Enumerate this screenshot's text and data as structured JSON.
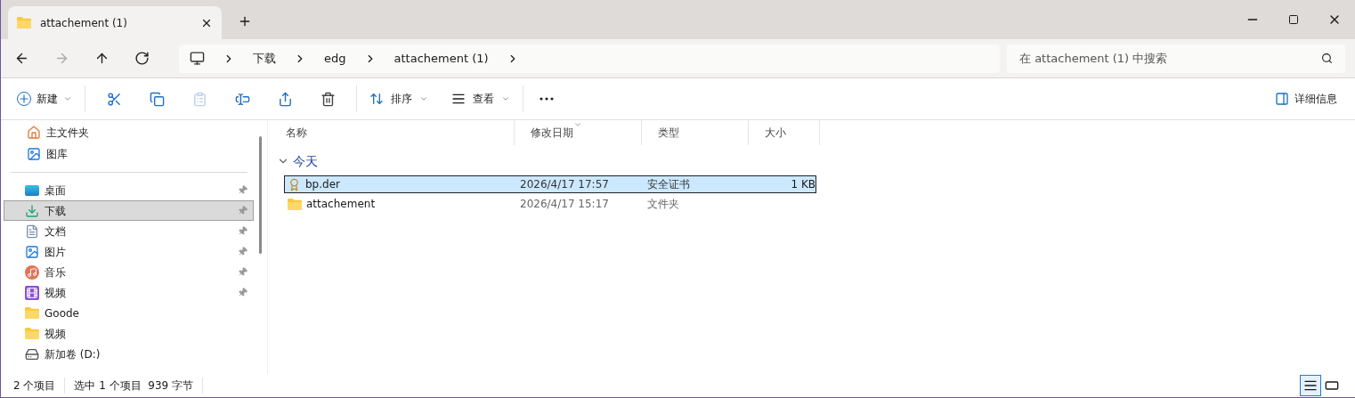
{
  "tab": {
    "title": "attachement (1)",
    "selected": true
  },
  "nav": [
    {
      "disabled": false
    },
    {
      "disabled": true
    },
    {
      "disabled": false
    },
    {
      "disabled": false
    }
  ],
  "breadcrumb": [
    "下载",
    "edg",
    "attachement (1)"
  ],
  "search": {
    "placeholder": "在 attachement (1) 中搜索"
  },
  "toolbar": {
    "new": {
      "label": "新建"
    },
    "actions": [
      {
        "disabled": false
      },
      {
        "disabled": false
      },
      {
        "disabled": true
      },
      {
        "disabled": false
      },
      {
        "disabled": false
      },
      {
        "disabled": false
      }
    ],
    "sort": {
      "label": "排序"
    },
    "view": {
      "label": "查看"
    },
    "details": {
      "label": "详细信息"
    }
  },
  "sidebar": {
    "top_items": [
      {
        "label": "主文件夹"
      },
      {
        "label": "图库"
      }
    ],
    "items": [
      {
        "label": "桌面",
        "pinned": true,
        "selected": false
      },
      {
        "label": "下载",
        "pinned": true,
        "selected": true
      },
      {
        "label": "文档",
        "pinned": true,
        "selected": false
      },
      {
        "label": "图片",
        "pinned": true,
        "selected": false
      },
      {
        "label": "音乐",
        "pinned": true,
        "selected": false
      },
      {
        "label": "视频",
        "pinned": true,
        "selected": false
      },
      {
        "label": "Goode",
        "pinned": false,
        "selected": false
      },
      {
        "label": "视频",
        "pinned": false,
        "selected": false
      },
      {
        "label": "新加卷 (D:)",
        "pinned": false,
        "selected": false
      }
    ]
  },
  "table": {
    "columns": [
      {
        "label": "名称",
        "sorted": false
      },
      {
        "label": "修改日期",
        "sorted": true
      },
      {
        "label": "类型",
        "sorted": false
      },
      {
        "label": "大小",
        "sorted": false
      }
    ],
    "group": {
      "label": "今天",
      "expanded": true
    },
    "rows": [
      {
        "kind": "certificate",
        "name": "bp.der",
        "date": "2026/4/17 17:57",
        "type": "安全证书",
        "size": "1 KB",
        "selected": true
      },
      {
        "kind": "folder",
        "name": "attachement",
        "date": "2026/4/17 15:17",
        "type": "文件夹",
        "size": "",
        "selected": false
      }
    ]
  },
  "status_bar": {
    "count": "2 个项目",
    "selection": "选中 1 个项目  939 字节",
    "views": [
      {
        "selected": true
      },
      {
        "selected": false
      }
    ]
  }
}
